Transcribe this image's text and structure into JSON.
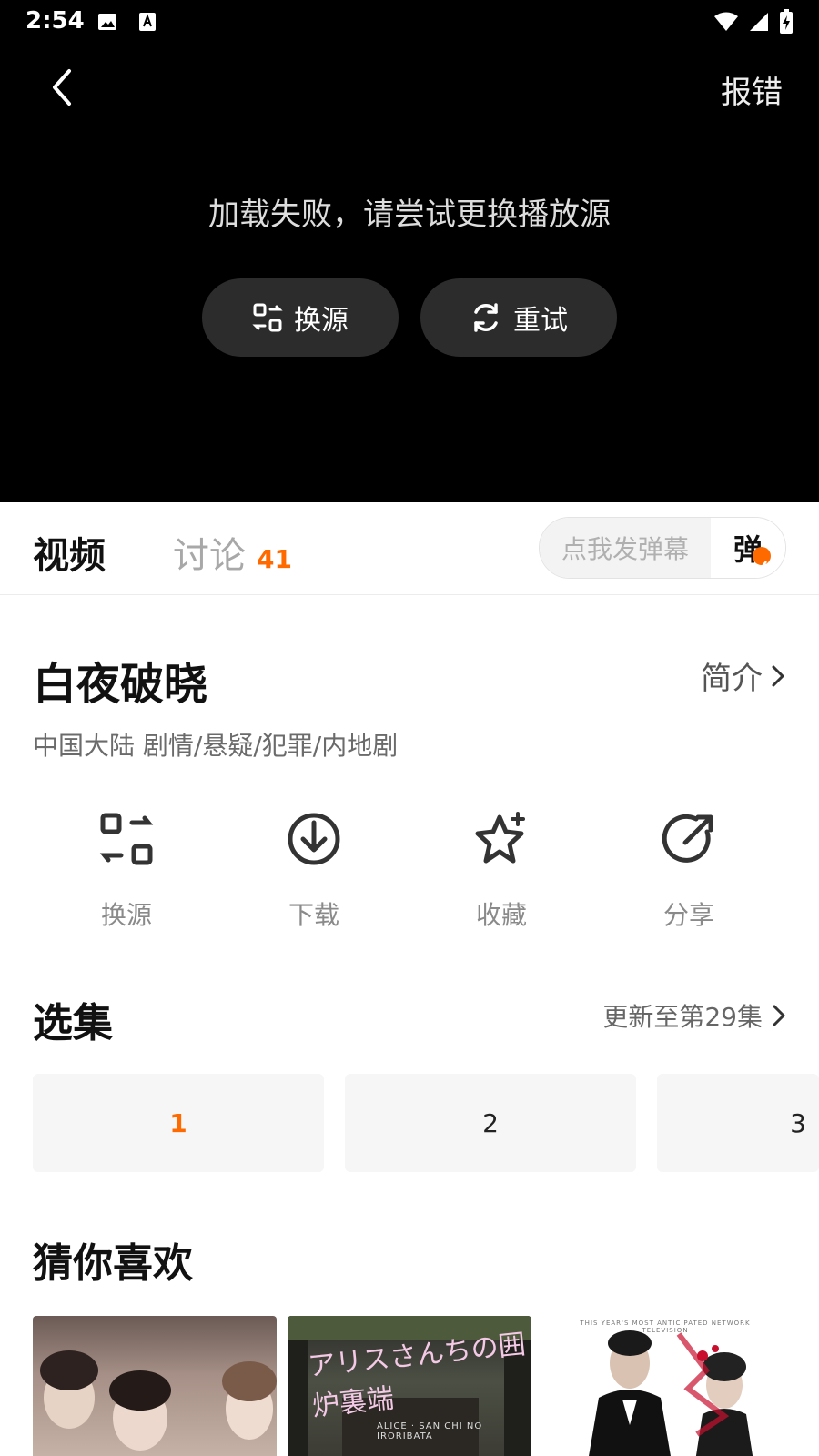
{
  "status_bar": {
    "time": "2:54",
    "icons": [
      "image-icon",
      "font-icon",
      "wifi-icon",
      "signal-icon",
      "battery-charging-icon"
    ]
  },
  "player": {
    "report_label": "报错",
    "error_message": "加载失败，请尝试更换播放源",
    "switch_source_label": "换源",
    "retry_label": "重试"
  },
  "tabs": {
    "video_label": "视频",
    "discuss_label": "讨论",
    "discuss_count": "41",
    "danmu_placeholder": "点我发弹幕",
    "danmu_toggle_label": "弹"
  },
  "show": {
    "title": "白夜破晓",
    "intro_label": "简介",
    "meta": "中国大陆  剧情/悬疑/犯罪/内地剧"
  },
  "actions": [
    {
      "label": "换源",
      "icon": "switch-source-icon"
    },
    {
      "label": "下载",
      "icon": "download-icon"
    },
    {
      "label": "收藏",
      "icon": "favorite-star-icon"
    },
    {
      "label": "分享",
      "icon": "share-icon"
    }
  ],
  "episodes": {
    "title": "选集",
    "update_text": "更新至第29集",
    "items": [
      "1",
      "2",
      "3"
    ],
    "selected_index": 0
  },
  "recommend": {
    "title": "猜你喜欢",
    "posters": [
      {
        "text": ""
      },
      {
        "text": "アリスさんちの囲炉裏端",
        "subtext": "ALICE · SAN CHI NO IRORIBATA"
      },
      {
        "text": "THIS YEAR'S MOST ANTICIPATED NETWORK TELEVISION"
      }
    ]
  },
  "colors": {
    "accent": "#ff6a00",
    "player_bg": "#000000",
    "button_bg": "#2c2c2c",
    "episode_bg": "#f6f6f6"
  }
}
